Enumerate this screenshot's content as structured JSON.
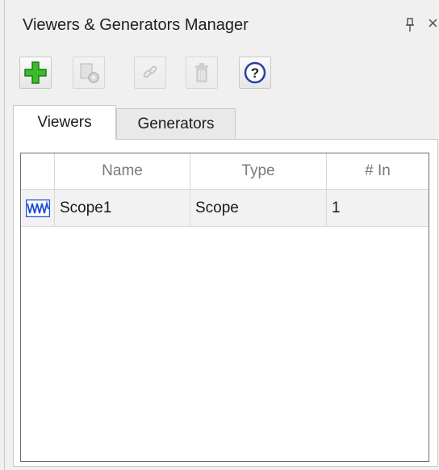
{
  "window": {
    "title": "Viewers & Generators Manager",
    "close_glyph": "×"
  },
  "toolbar": {
    "buttons": [
      {
        "icon": "add-icon",
        "enabled": true
      },
      {
        "icon": "scope-parameters-icon",
        "enabled": false
      },
      {
        "icon": "link-icon",
        "enabled": false
      },
      {
        "icon": "delete-icon",
        "enabled": false
      },
      {
        "icon": "help-icon",
        "enabled": true,
        "glyph": "?"
      }
    ]
  },
  "tabs": [
    {
      "label": "Viewers",
      "active": true
    },
    {
      "label": "Generators",
      "active": false
    }
  ],
  "table": {
    "columns": [
      "",
      "Name",
      "Type",
      "# In"
    ],
    "rows": [
      {
        "icon": "scope-signal-icon",
        "name": "Scope1",
        "type": "Scope",
        "inputs": "1"
      }
    ]
  },
  "colors": {
    "add_green": "#3dbb2e",
    "scope_icon_blue": "#1f4fd6",
    "help_border": "#2a3f9e"
  }
}
